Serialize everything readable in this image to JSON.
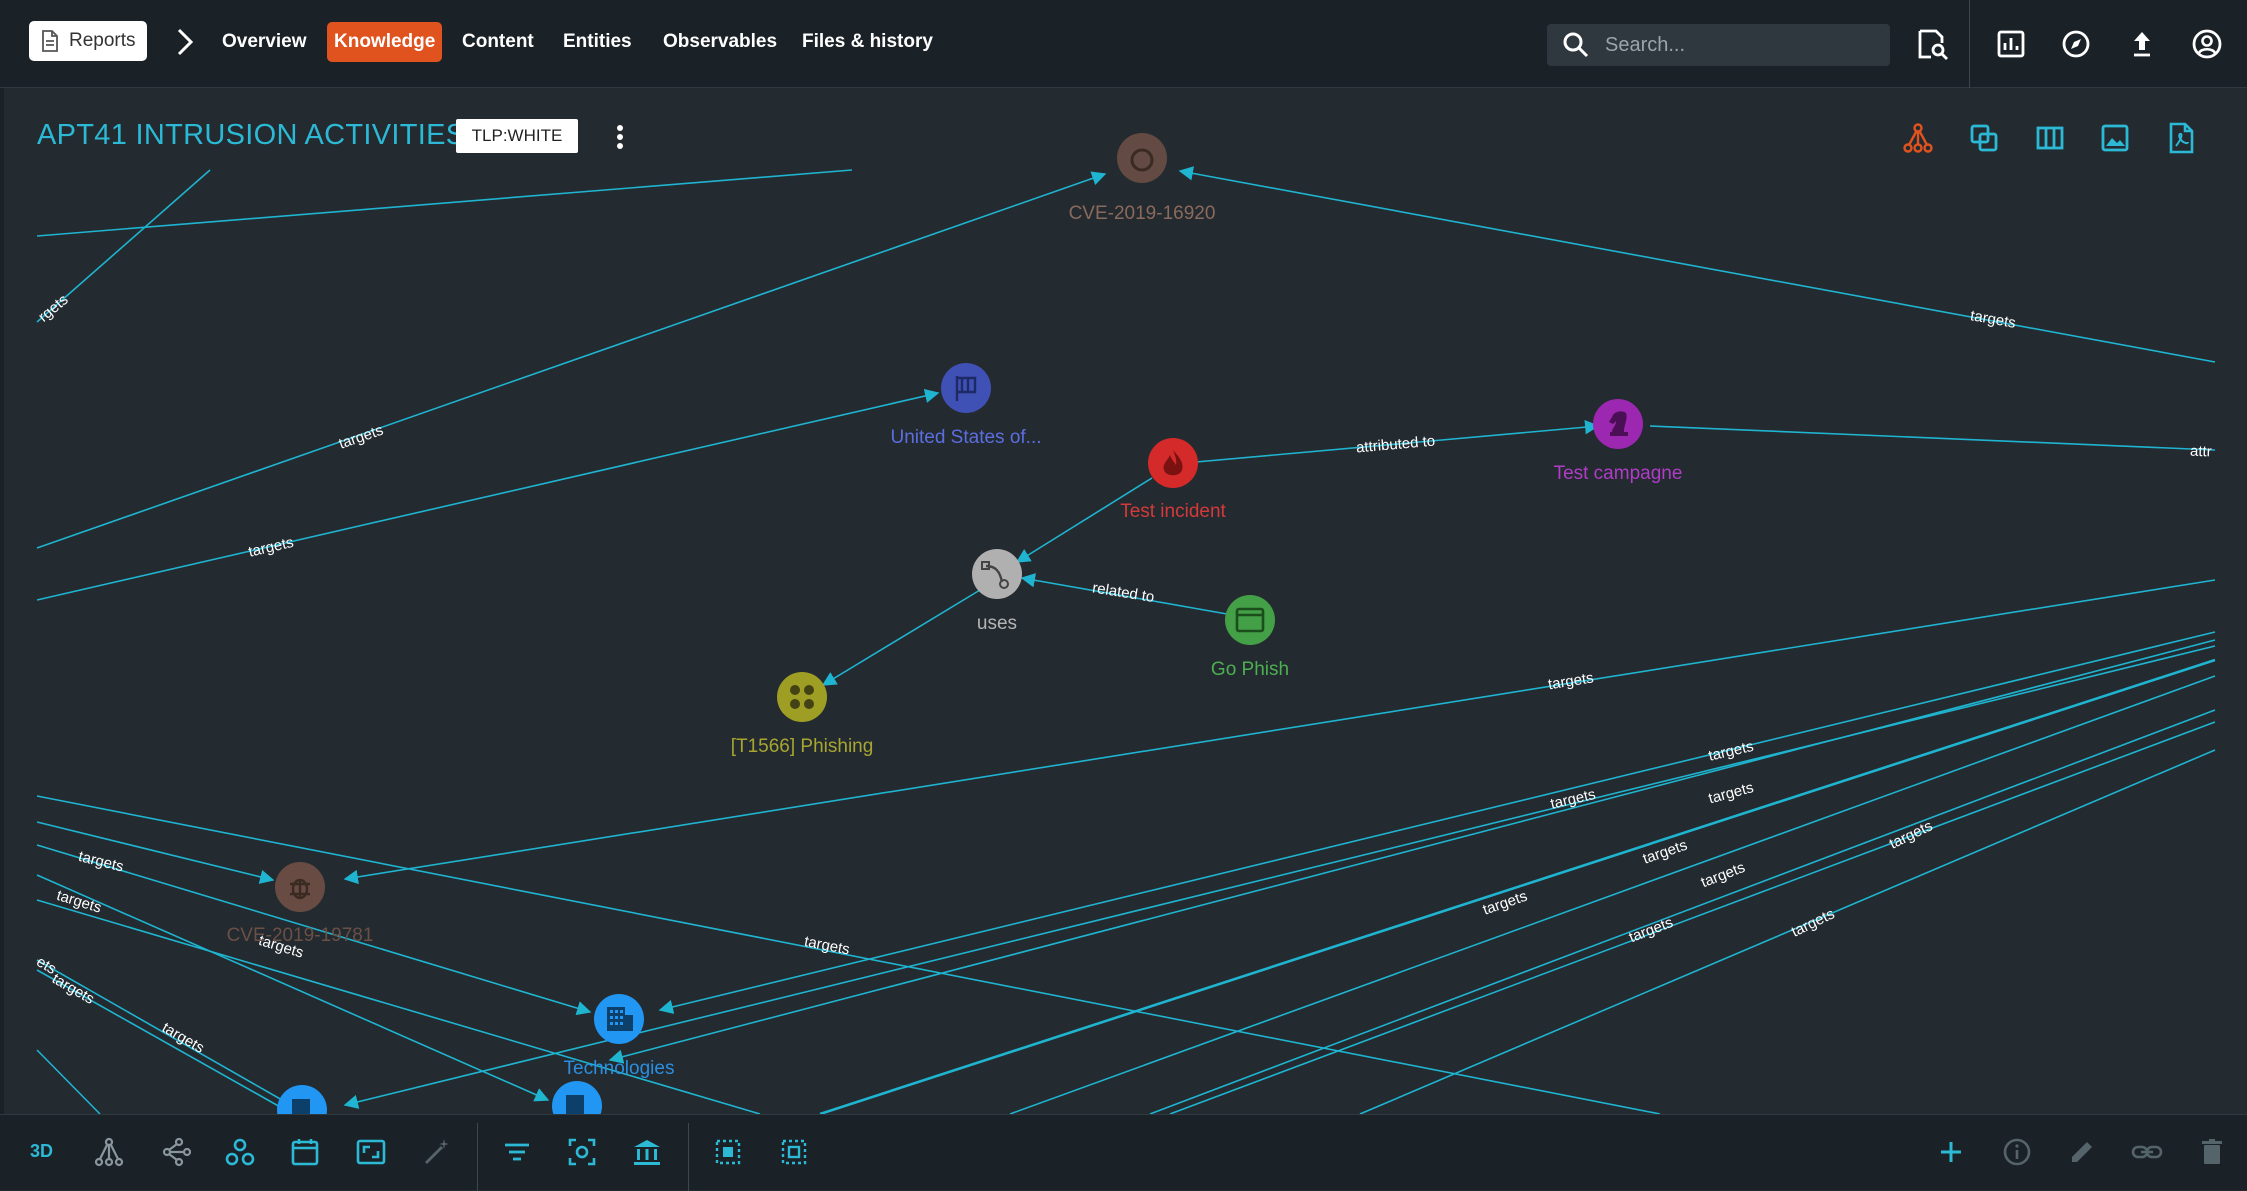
{
  "topbar": {
    "reports_label": "Reports",
    "nav": [
      "Overview",
      "Knowledge",
      "Content",
      "Entities",
      "Observables",
      "Files & history"
    ],
    "active_nav": "Knowledge",
    "search_placeholder": "Search..."
  },
  "report": {
    "title": "APT41 INTRUSION ACTIVITIES",
    "marking": "TLP:WHITE"
  },
  "graph": {
    "nodes": {
      "cve16920": "CVE-2019-16920",
      "united_states": "United States of...",
      "test_incident": "Test incident",
      "test_campagne": "Test campagne",
      "uses": "uses",
      "go_phish": "Go Phish",
      "phishing": "[T1566] Phishing",
      "cve19781": "CVE-2019-19781",
      "technologies": "Technologies"
    },
    "edge_labels": {
      "targets": "targets",
      "attributed_to": "attributed to",
      "related_to": "related to",
      "attr_cut": "attr",
      "rgets_cut": "rgets",
      "ets_cut": "ets"
    }
  },
  "colors": {
    "accent": "#2bb9d6",
    "active_tab": "#e0531f",
    "edge": "#1fb4d0",
    "incident": "#d42a2a",
    "campaign": "#9c27b0",
    "country": "#3f51b5",
    "tool": "#43a047",
    "attack_pattern": "#9e9d24",
    "vulnerability": "#795548",
    "organization": "#2196f3"
  },
  "icons": {
    "toolbar_right": [
      "tree-layout-icon",
      "selection-icon",
      "columns-icon",
      "image-export-icon",
      "pdf-export-icon"
    ],
    "topbar_right": [
      "search-document-icon",
      "dashboard-icon",
      "explore-icon",
      "upload-icon",
      "account-icon"
    ],
    "bottom_left": [
      "3d-toggle",
      "tree-mode-icon",
      "force-mode-icon",
      "correlation-icon",
      "timeline-icon",
      "fit-screen-icon",
      "auto-layout-icon",
      "filter-icon",
      "focus-icon",
      "institution-icon",
      "select-all-icon",
      "select-by-type-icon"
    ],
    "bottom_right": [
      "add-icon",
      "info-icon",
      "edit-icon",
      "link-icon",
      "delete-icon"
    ]
  },
  "bottombar": {
    "mode_3d": "3D"
  }
}
